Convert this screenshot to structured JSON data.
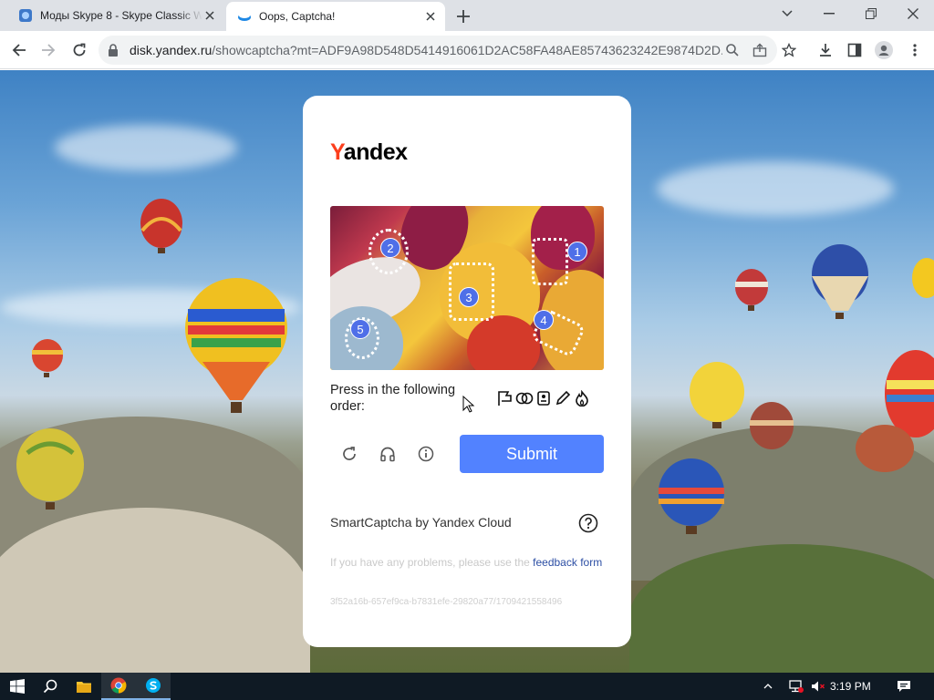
{
  "tabs": [
    {
      "title": "Моды Skype 8 - Skype Classic Wi",
      "active": false
    },
    {
      "title": "Oops, Captcha!",
      "active": true
    }
  ],
  "address": {
    "domain": "disk.yandex.ru",
    "path": "/showcaptcha?mt=ADF9A98D548D5414916061D2AC58FA48AE85743623242E9874D2D..."
  },
  "captcha": {
    "logo_first": "Y",
    "logo_rest": "andex",
    "marks": [
      "1",
      "2",
      "3",
      "4",
      "5"
    ],
    "instruction": "Press in the following order:",
    "sequence_icons": [
      "flag-icon",
      "rings-icon",
      "badge-icon",
      "pencil-icon",
      "flame-icon"
    ],
    "submit_label": "Submit",
    "brand_text": "SmartCaptcha by Yandex Cloud",
    "feedback_prefix": "If you have any problems, please use the",
    "feedback_link": "feedback form",
    "request_id": "3f52a16b-657ef9ca-b7831efe-29820a77/1709421558496"
  },
  "taskbar": {
    "time": "3:19 PM",
    "apps": [
      "start-icon",
      "search-icon",
      "file-explorer-icon",
      "chrome-icon",
      "skype-icon"
    ]
  },
  "colors": {
    "submit": "#5282ff",
    "marker": "#4f6fe8",
    "yandex_red": "#fc3f1d"
  }
}
